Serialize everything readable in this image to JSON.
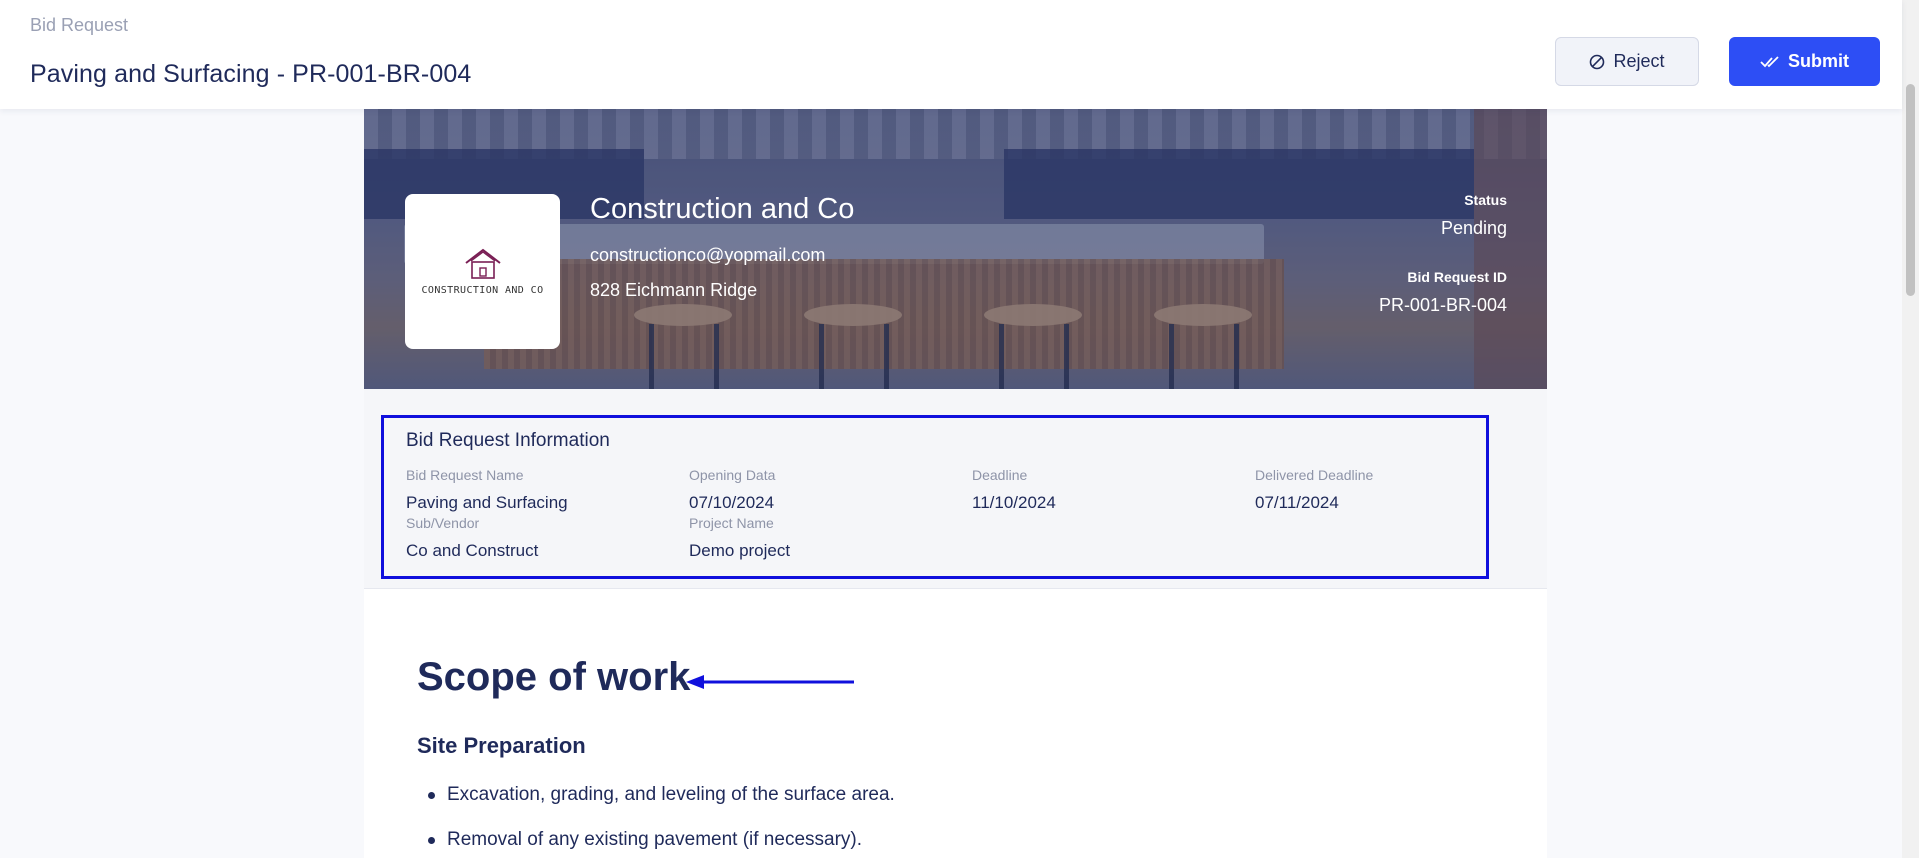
{
  "header": {
    "breadcrumb": "Bid Request",
    "title": "Paving and Surfacing - PR-001-BR-004",
    "reject_label": "Reject",
    "submit_label": "Submit"
  },
  "company": {
    "logo_text": "CONSTRUCTION AND CO",
    "name": "Construction and Co",
    "email": "constructionco@yopmail.com",
    "address": "828 Eichmann Ridge",
    "status_label": "Status",
    "status_value": "Pending",
    "bid_id_label": "Bid Request ID",
    "bid_id_value": "PR-001-BR-004"
  },
  "info": {
    "title": "Bid Request Information",
    "fields": [
      {
        "label": "Bid Request Name",
        "value": "Paving and Surfacing"
      },
      {
        "label": "Opening Data",
        "value": "07/10/2024"
      },
      {
        "label": "Deadline",
        "value": "11/10/2024"
      },
      {
        "label": "Delivered Deadline",
        "value": "07/11/2024"
      },
      {
        "label": "Sub/Vendor",
        "value": "Co and Construct"
      },
      {
        "label": "Project Name",
        "value": "Demo project"
      }
    ]
  },
  "scope": {
    "title": "Scope of work",
    "section_title": "Site Preparation",
    "items": [
      "Excavation, grading, and leveling of the surface area.",
      "Removal of any existing pavement (if necessary)."
    ]
  },
  "colors": {
    "primary": "#2d4ef5",
    "text": "#1f2a5a",
    "annotation": "#1010dd"
  },
  "icons": {
    "reject": "ban-icon",
    "submit": "double-check-icon"
  }
}
